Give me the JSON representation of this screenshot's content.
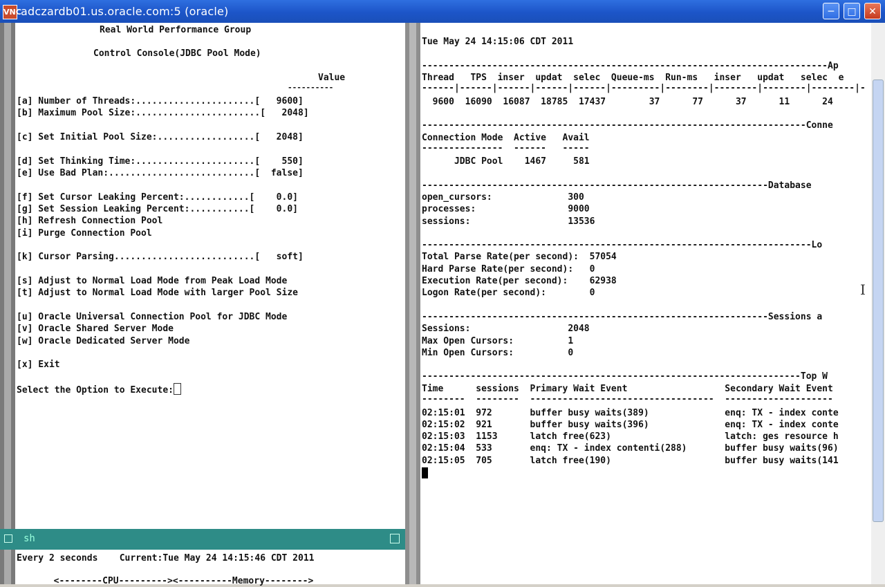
{
  "window": {
    "title": "adczardb01.us.oracle.com:5 (oracle)",
    "app_icon": "VNC",
    "buttons": [
      "minimize-icon",
      "maximize-icon",
      "close-icon"
    ]
  },
  "left": {
    "header1": "Real World Performance Group",
    "header2": "Control Console(JDBC Pool Mode)",
    "value_header": "Value",
    "value_underline": "----------",
    "options": [
      "[a] Number of Threads:......................[   9600]",
      "[b] Maximum Pool Size:.......................[   2048]",
      "[c] Set Initial Pool Size:..................[   2048]",
      "[d] Set Thinking Time:......................[    550]",
      "[e] Use Bad Plan:...........................[  false]",
      "[f] Set Cursor Leaking Percent:............[    0.0]",
      "[g] Set Session Leaking Percent:...........[    0.0]",
      "[h] Refresh Connection Pool",
      "[i] Purge Connection Pool",
      "[k] Cursor Parsing..........................[   soft]",
      "[s] Adjust to Normal Load Mode from Peak Load Mode",
      "[t] Adjust to Normal Load Mode with larger Pool Size",
      "[u] Oracle Universal Connection Pool for JDBC Mode",
      "[v] Oracle Shared Server Mode",
      "[w] Oracle Dedicated Server Mode",
      "[x] Exit"
    ],
    "prompt": "Select the Option to Execute:"
  },
  "shell": {
    "tab_label": "sh",
    "watch_line": "Every 2 seconds    Current:Tue May 24 14:15:46 CDT 2011",
    "cpu_mem_line": "  <--------CPU---------><----------Memory-------->"
  },
  "right": {
    "timestamp": "Tue May 24 14:15:06 CDT 2011",
    "ap_rule": "---------------------------------------------------------------------------Ap",
    "thread_header": "Thread   TPS  inser  updat  selec  Queue-ms  Run-ms   inser   updat   selec  e",
    "thread_rule": "------|------|------|------|------|---------|--------|--------|--------|--------|-",
    "thread_row": "  9600  16090  16087  18785  17437        37      77      37      11      24",
    "conn_rule": "-----------------------------------------------------------------------Conne",
    "conn_header": "Connection Mode  Active   Avail",
    "conn_header_rule": "---------------  ------   -----",
    "conn_row": "      JDBC Pool    1467     581",
    "db_rule": "----------------------------------------------------------------Database",
    "db_rows": [
      "open_cursors:              300",
      "processes:                 9000",
      "sessions:                  13536"
    ],
    "lo_rule": "------------------------------------------------------------------------Lo",
    "rate_rows": [
      "Total Parse Rate(per second):  57054",
      "Hard Parse Rate(per second):   0",
      "Execution Rate(per second):    62938",
      "Logon Rate(per second):        0"
    ],
    "sessions_rule": "----------------------------------------------------------------Sessions a",
    "session_rows": [
      "Sessions:                  2048",
      "Max Open Cursors:          1",
      "Min Open Cursors:          0"
    ],
    "top_rule": "----------------------------------------------------------------------Top W",
    "wait_header": "Time      sessions  Primary Wait Event                  Secondary Wait Event",
    "wait_header_rule": "--------  --------  ----------------------------------  --------------------",
    "wait_rows": [
      "02:15:01  972       buffer busy waits(389)              enq: TX - index conte",
      "02:15:02  921       buffer busy waits(396)              enq: TX - index conte",
      "02:15:03  1153      latch free(623)                     latch: ges resource h",
      "02:15:04  533       enq: TX - index contenti(288)       buffer busy waits(96)",
      "02:15:05  705       latch free(190)                     buffer busy waits(141"
    ]
  }
}
